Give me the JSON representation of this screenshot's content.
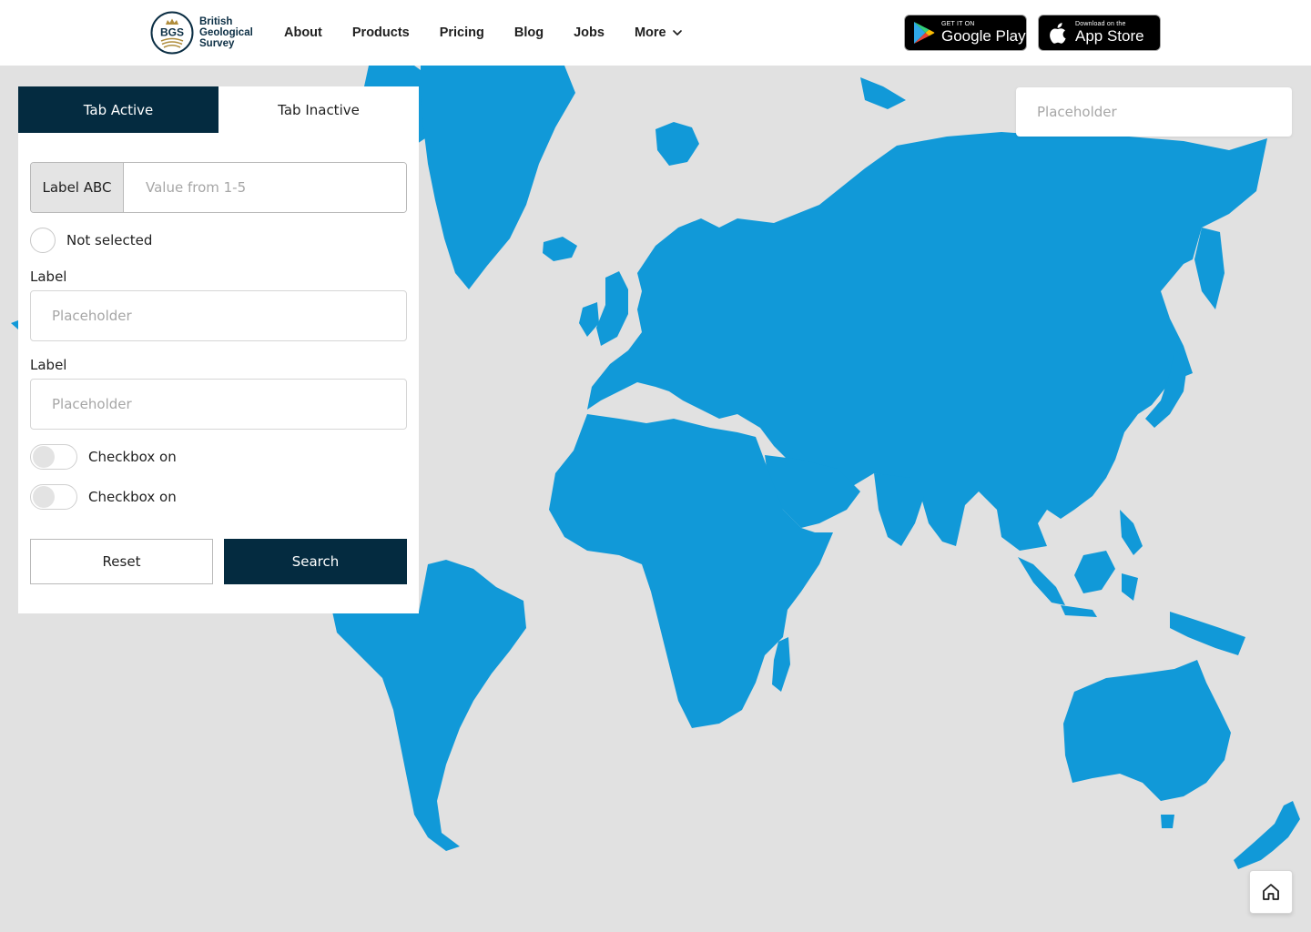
{
  "header": {
    "logo": {
      "abbr": "BGS",
      "line1": "British",
      "line2": "Geological",
      "line3": "Survey"
    },
    "nav": [
      {
        "label": "About"
      },
      {
        "label": "Products"
      },
      {
        "label": "Pricing"
      },
      {
        "label": "Blog"
      },
      {
        "label": "Jobs"
      },
      {
        "label": "More",
        "icon": "chevron-down-icon"
      }
    ],
    "google_play": {
      "small": "GET IT ON",
      "big": "Google Play"
    },
    "app_store": {
      "small": "Download on the",
      "big": "App Store"
    }
  },
  "panel": {
    "tabs": [
      {
        "label": "Tab Active",
        "active": true
      },
      {
        "label": "Tab Inactive",
        "active": false
      }
    ],
    "addon_field": {
      "label": "Label ABC",
      "value": "",
      "placeholder": "Value from 1-5"
    },
    "radio": {
      "label": "Not selected",
      "selected": false
    },
    "fields": [
      {
        "label": "Label",
        "value": "",
        "placeholder": "Placeholder"
      },
      {
        "label": "Label",
        "value": "",
        "placeholder": "Placeholder"
      }
    ],
    "toggles": [
      {
        "label": "Checkbox on",
        "on": false
      },
      {
        "label": "Checkbox on",
        "on": false
      }
    ],
    "reset_label": "Reset",
    "search_label": "Search"
  },
  "map_search": {
    "value": "",
    "placeholder": "Placeholder"
  },
  "home_button": {
    "icon": "home-icon"
  },
  "colors": {
    "primary_dark": "#042b40",
    "land": "#1199d8",
    "water": "#e1e1e1"
  }
}
